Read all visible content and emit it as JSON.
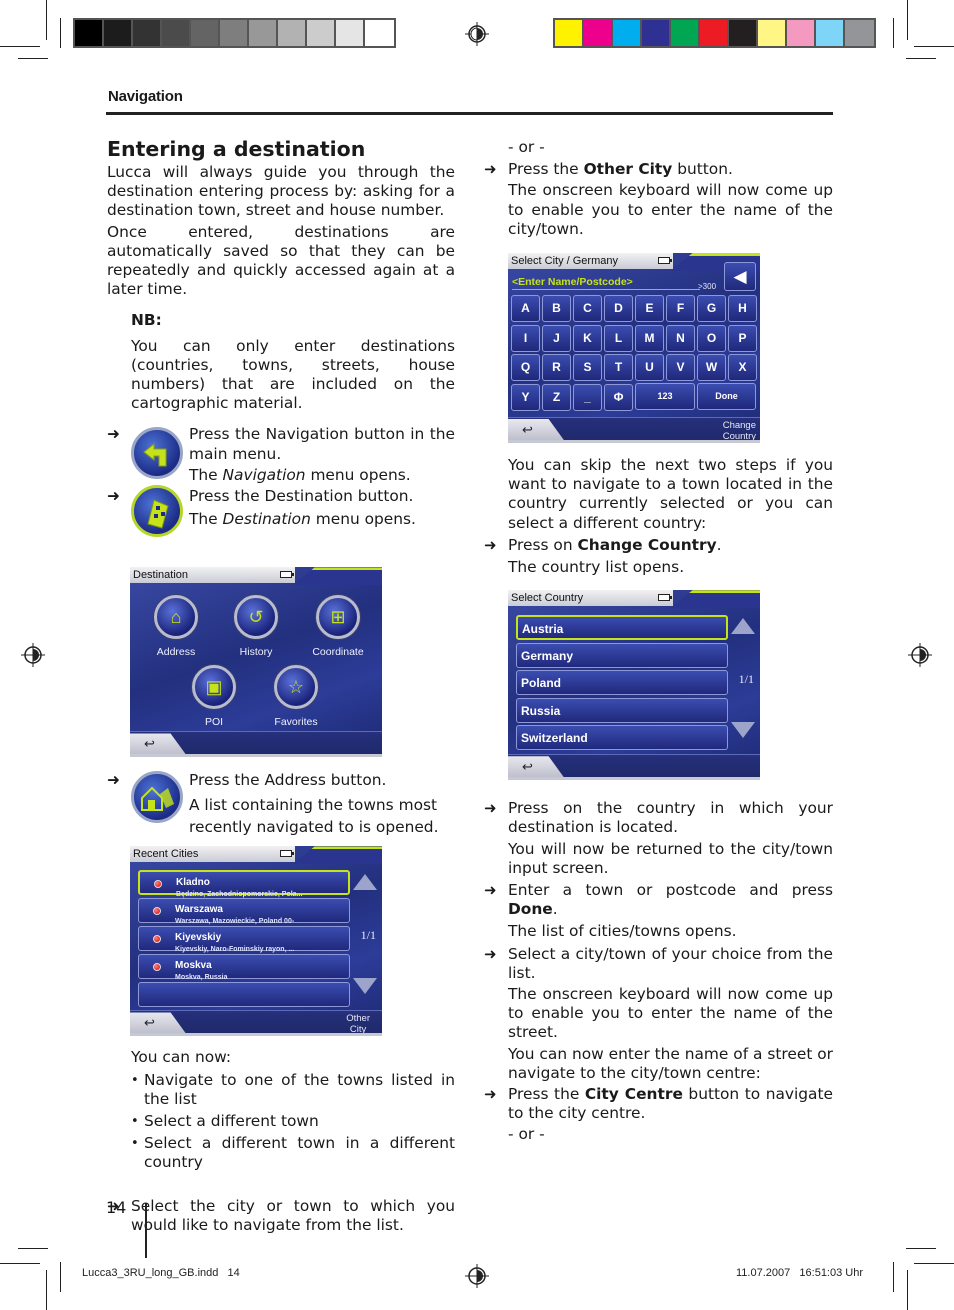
{
  "printer_marks": {
    "grayscale_swatches": [
      "#000000",
      "#1c1c1c",
      "#333333",
      "#4b4b4b",
      "#646464",
      "#7e7e7e",
      "#989898",
      "#b2b2b2",
      "#cccccc",
      "#e5e5e5",
      "#ffffff"
    ],
    "color_swatches": [
      "#fff200",
      "#ec008c",
      "#00aeef",
      "#2e3192",
      "#00a651",
      "#ed1c24",
      "#231f20",
      "#fff685",
      "#f49ac1",
      "#7fd5f7",
      "#939598"
    ],
    "slug_left": "Lucca3_3RU_long_GB.indd   14",
    "slug_right": "11.07.2007   16:51:03 Uhr"
  },
  "header": {
    "title": "Navigation"
  },
  "page_number": "14",
  "left_column": {
    "section_title": "Entering a destination",
    "intro_1": "Lucca will always guide you through the destination entering process by: asking for a destination town, street and house number.",
    "intro_2": "Once entered, destinations are automatically saved so that they can be repeatedly and quickly accessed again at a later time.",
    "nb_title": "NB:",
    "nb_text": "You can only enter destinations (countries, towns, streets, house numbers) that are included on the cartographic material.",
    "step_navigation": {
      "line1": "Press the Navigation button in the main menu.",
      "line2_pre": "The ",
      "line2_em": "Navigation",
      "line2_post": " menu opens."
    },
    "step_destination": {
      "line1": "Press the Destination button.",
      "line2_pre": "The ",
      "line2_em": "Destination",
      "line2_post": " menu opens."
    },
    "destination_screen": {
      "title": "Destination",
      "buttons": [
        {
          "label": "Address",
          "icon": "house-flag-icon"
        },
        {
          "label": "History",
          "icon": "history-icon"
        },
        {
          "label": "Coordinate",
          "icon": "coordinate-icon"
        },
        {
          "label": "POI",
          "icon": "poi-icon"
        },
        {
          "label": "Favorites",
          "icon": "star-icon"
        }
      ],
      "back_icon": "↩"
    },
    "step_address": {
      "line1": "Press the Address button.",
      "line2": "A list containing the towns most recently navigated to is opened."
    },
    "recent_cities_screen": {
      "title": "Recent Cities",
      "rows": [
        {
          "city": "Kladno",
          "region": "Będzino, Zachodniopomorskie, Pola..."
        },
        {
          "city": "Warszawa",
          "region": "Warszawa, Mazowieckie, Poland 00-"
        },
        {
          "city": "Kiyevskiy",
          "region": "Kiyevskiy, Naro-Fominskiy rayon, ..."
        },
        {
          "city": "Moskva",
          "region": "Moskva, Russia"
        }
      ],
      "pager": "1/1",
      "other_city_line1": "Other",
      "other_city_line2": "City",
      "back_icon": "↩"
    },
    "you_can_now": "You can now:",
    "options": [
      "Navigate to one of the towns listed in the list",
      "Select a different town",
      "Select a different town in a different country"
    ],
    "step_select_city": "Select the city or town to which you would like to navigate from the list."
  },
  "right_column": {
    "or_1": "- or -",
    "step_other_city": {
      "pre": "Press the ",
      "bold": "Other City",
      "post": " button."
    },
    "keyboard_note": "The onscreen keyboard will now come up to enable you to enter the name of the city/town.",
    "keyboard_screen": {
      "title": "Select City / Germany",
      "input_placeholder": "<Enter Name/Postcode>",
      "result_count": ">300",
      "backspace_icon": "◀",
      "keys": [
        "A",
        "B",
        "C",
        "D",
        "E",
        "F",
        "G",
        "H",
        "I",
        "J",
        "K",
        "L",
        "M",
        "N",
        "O",
        "P",
        "Q",
        "R",
        "S",
        "T",
        "U",
        "V",
        "W",
        "X",
        "Y",
        "Z",
        "_",
        "Φ"
      ],
      "key_123": "123",
      "key_done": "Done",
      "change_country_line1": "Change",
      "change_country_line2": "Country",
      "back_icon": "↩"
    },
    "skip_note": "You can skip the next two steps if you want to navigate to a town located in the country currently selected or you can select a different country:",
    "step_change_country": {
      "pre": "Press on ",
      "bold": "Change Country",
      "post": "."
    },
    "country_list_opens": "The country list opens.",
    "country_screen": {
      "title": "Select Country",
      "countries": [
        "Austria",
        "Germany",
        "Poland",
        "Russia",
        "Switzerland"
      ],
      "pager": "1/1",
      "back_icon": "↩"
    },
    "step_press_country": "Press on the country in which your destination is located.",
    "returned_note": "You will now be returned to the city/town input screen.",
    "step_enter_town": {
      "pre": "Enter a town or postcode and press ",
      "bold": "Done",
      "post": "."
    },
    "list_opens": "The list of cities/towns opens.",
    "step_select_town": "Select a city/town of your choice from the list.",
    "street_keyboard_note": "The onscreen keyboard will now come up to enable you to enter the name of the street.",
    "street_or_centre_note": "You can now enter the name of a street or navigate to the city/town centre:",
    "step_city_centre": {
      "pre": "Press the ",
      "bold": "City Centre",
      "post": " button to navigate to the city centre."
    },
    "or_2": "- or -"
  }
}
